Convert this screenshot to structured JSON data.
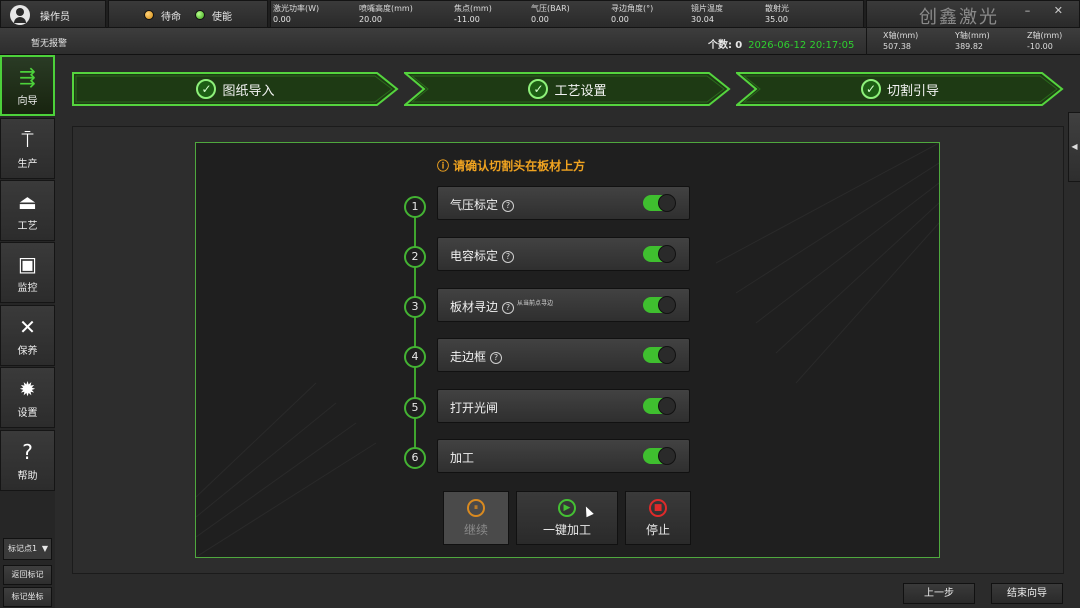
{
  "topbar": {
    "operator": "操作员",
    "status_standby": "待命",
    "status_enable": "使能",
    "params": [
      {
        "label": "激光功率(W)",
        "value": "0.00"
      },
      {
        "label": "喷嘴高度(mm)",
        "value": "20.00"
      },
      {
        "label": "焦点(mm)",
        "value": "-11.00"
      },
      {
        "label": "气压(BAR)",
        "value": "0.00"
      },
      {
        "label": "寻边角度(°)",
        "value": "0.00"
      },
      {
        "label": "镜片温度",
        "value": "30.04"
      },
      {
        "label": "散射光",
        "value": "35.00"
      }
    ],
    "brand": "创鑫激光",
    "window_controls": "–  ✕"
  },
  "bar2": {
    "alarm": "暂无报警",
    "count_label": "个数:",
    "count_value": "0",
    "datetime": "2026-06-12 20:17:05",
    "axes": [
      {
        "label": "X轴(mm)",
        "value": "507.38"
      },
      {
        "label": "Y轴(mm)",
        "value": "389.82"
      },
      {
        "label": "Z轴(mm)",
        "value": "-10.00"
      }
    ]
  },
  "sidebar": {
    "items": [
      {
        "label": "向导",
        "icon": "signpost-icon",
        "glyph": "⇶"
      },
      {
        "label": "生产",
        "icon": "laser-head-icon",
        "glyph": "⍑"
      },
      {
        "label": "工艺",
        "icon": "anvil-icon",
        "glyph": "⏏"
      },
      {
        "label": "监控",
        "icon": "monitor-icon",
        "glyph": "▣"
      },
      {
        "label": "保养",
        "icon": "tools-icon",
        "glyph": "✕"
      },
      {
        "label": "设置",
        "icon": "gear-icon",
        "glyph": "✹"
      },
      {
        "label": "帮助",
        "icon": "help-doc-icon",
        "glyph": "?"
      }
    ],
    "mark_select": "标记点1",
    "return_mark": "返回标记",
    "mark_coord": "标记坐标"
  },
  "steps": [
    {
      "label": "图纸导入"
    },
    {
      "label": "工艺设置"
    },
    {
      "label": "切割引导"
    }
  ],
  "guide": {
    "notice": "ⓘ 请确认切割头在板材上方",
    "items": [
      {
        "num": "1",
        "label": "气压标定",
        "help": "?",
        "note": "",
        "enabled": true
      },
      {
        "num": "2",
        "label": "电容标定",
        "help": "?",
        "note": "",
        "enabled": true
      },
      {
        "num": "3",
        "label": "板材寻边",
        "help": "?",
        "note": "从当前点寻边",
        "enabled": true
      },
      {
        "num": "4",
        "label": "走边框",
        "help": "?",
        "note": "",
        "enabled": true
      },
      {
        "num": "5",
        "label": "打开光闸",
        "help": "",
        "note": "",
        "enabled": true
      },
      {
        "num": "6",
        "label": "加工",
        "help": "",
        "note": "",
        "enabled": true
      }
    ],
    "btn_continue": "继续",
    "btn_run": "一键加工",
    "btn_stop": "停止",
    "btn_continue_glyph": "⏸",
    "btn_run_glyph": "▶",
    "btn_stop_glyph": "■"
  },
  "footer": {
    "prev": "上一步",
    "finish": "结束向导"
  },
  "colors": {
    "accent_green": "#4cd13a",
    "notice_amber": "#f0a320",
    "stop_red": "#e02a2a"
  }
}
